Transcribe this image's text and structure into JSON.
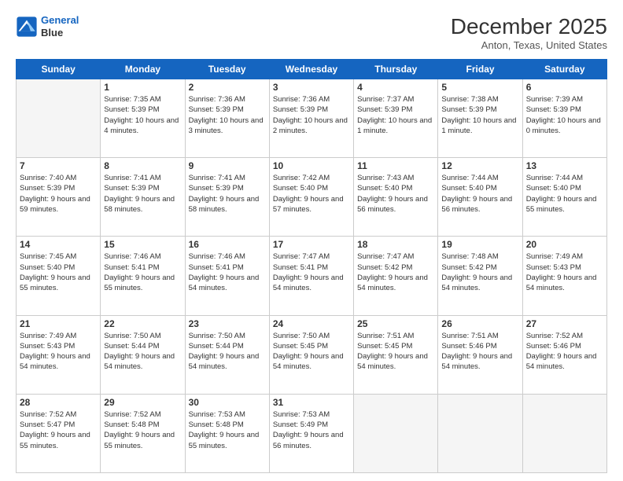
{
  "header": {
    "logo_line1": "General",
    "logo_line2": "Blue",
    "month": "December 2025",
    "location": "Anton, Texas, United States"
  },
  "days_of_week": [
    "Sunday",
    "Monday",
    "Tuesday",
    "Wednesday",
    "Thursday",
    "Friday",
    "Saturday"
  ],
  "weeks": [
    [
      {
        "day": "",
        "empty": true
      },
      {
        "day": "1",
        "sunrise": "Sunrise: 7:35 AM",
        "sunset": "Sunset: 5:39 PM",
        "daylight": "Daylight: 10 hours and 4 minutes."
      },
      {
        "day": "2",
        "sunrise": "Sunrise: 7:36 AM",
        "sunset": "Sunset: 5:39 PM",
        "daylight": "Daylight: 10 hours and 3 minutes."
      },
      {
        "day": "3",
        "sunrise": "Sunrise: 7:36 AM",
        "sunset": "Sunset: 5:39 PM",
        "daylight": "Daylight: 10 hours and 2 minutes."
      },
      {
        "day": "4",
        "sunrise": "Sunrise: 7:37 AM",
        "sunset": "Sunset: 5:39 PM",
        "daylight": "Daylight: 10 hours and 1 minute."
      },
      {
        "day": "5",
        "sunrise": "Sunrise: 7:38 AM",
        "sunset": "Sunset: 5:39 PM",
        "daylight": "Daylight: 10 hours and 1 minute."
      },
      {
        "day": "6",
        "sunrise": "Sunrise: 7:39 AM",
        "sunset": "Sunset: 5:39 PM",
        "daylight": "Daylight: 10 hours and 0 minutes."
      }
    ],
    [
      {
        "day": "7",
        "sunrise": "Sunrise: 7:40 AM",
        "sunset": "Sunset: 5:39 PM",
        "daylight": "Daylight: 9 hours and 59 minutes."
      },
      {
        "day": "8",
        "sunrise": "Sunrise: 7:41 AM",
        "sunset": "Sunset: 5:39 PM",
        "daylight": "Daylight: 9 hours and 58 minutes."
      },
      {
        "day": "9",
        "sunrise": "Sunrise: 7:41 AM",
        "sunset": "Sunset: 5:39 PM",
        "daylight": "Daylight: 9 hours and 58 minutes."
      },
      {
        "day": "10",
        "sunrise": "Sunrise: 7:42 AM",
        "sunset": "Sunset: 5:40 PM",
        "daylight": "Daylight: 9 hours and 57 minutes."
      },
      {
        "day": "11",
        "sunrise": "Sunrise: 7:43 AM",
        "sunset": "Sunset: 5:40 PM",
        "daylight": "Daylight: 9 hours and 56 minutes."
      },
      {
        "day": "12",
        "sunrise": "Sunrise: 7:44 AM",
        "sunset": "Sunset: 5:40 PM",
        "daylight": "Daylight: 9 hours and 56 minutes."
      },
      {
        "day": "13",
        "sunrise": "Sunrise: 7:44 AM",
        "sunset": "Sunset: 5:40 PM",
        "daylight": "Daylight: 9 hours and 55 minutes."
      }
    ],
    [
      {
        "day": "14",
        "sunrise": "Sunrise: 7:45 AM",
        "sunset": "Sunset: 5:40 PM",
        "daylight": "Daylight: 9 hours and 55 minutes."
      },
      {
        "day": "15",
        "sunrise": "Sunrise: 7:46 AM",
        "sunset": "Sunset: 5:41 PM",
        "daylight": "Daylight: 9 hours and 55 minutes."
      },
      {
        "day": "16",
        "sunrise": "Sunrise: 7:46 AM",
        "sunset": "Sunset: 5:41 PM",
        "daylight": "Daylight: 9 hours and 54 minutes."
      },
      {
        "day": "17",
        "sunrise": "Sunrise: 7:47 AM",
        "sunset": "Sunset: 5:41 PM",
        "daylight": "Daylight: 9 hours and 54 minutes."
      },
      {
        "day": "18",
        "sunrise": "Sunrise: 7:47 AM",
        "sunset": "Sunset: 5:42 PM",
        "daylight": "Daylight: 9 hours and 54 minutes."
      },
      {
        "day": "19",
        "sunrise": "Sunrise: 7:48 AM",
        "sunset": "Sunset: 5:42 PM",
        "daylight": "Daylight: 9 hours and 54 minutes."
      },
      {
        "day": "20",
        "sunrise": "Sunrise: 7:49 AM",
        "sunset": "Sunset: 5:43 PM",
        "daylight": "Daylight: 9 hours and 54 minutes."
      }
    ],
    [
      {
        "day": "21",
        "sunrise": "Sunrise: 7:49 AM",
        "sunset": "Sunset: 5:43 PM",
        "daylight": "Daylight: 9 hours and 54 minutes."
      },
      {
        "day": "22",
        "sunrise": "Sunrise: 7:50 AM",
        "sunset": "Sunset: 5:44 PM",
        "daylight": "Daylight: 9 hours and 54 minutes."
      },
      {
        "day": "23",
        "sunrise": "Sunrise: 7:50 AM",
        "sunset": "Sunset: 5:44 PM",
        "daylight": "Daylight: 9 hours and 54 minutes."
      },
      {
        "day": "24",
        "sunrise": "Sunrise: 7:50 AM",
        "sunset": "Sunset: 5:45 PM",
        "daylight": "Daylight: 9 hours and 54 minutes."
      },
      {
        "day": "25",
        "sunrise": "Sunrise: 7:51 AM",
        "sunset": "Sunset: 5:45 PM",
        "daylight": "Daylight: 9 hours and 54 minutes."
      },
      {
        "day": "26",
        "sunrise": "Sunrise: 7:51 AM",
        "sunset": "Sunset: 5:46 PM",
        "daylight": "Daylight: 9 hours and 54 minutes."
      },
      {
        "day": "27",
        "sunrise": "Sunrise: 7:52 AM",
        "sunset": "Sunset: 5:46 PM",
        "daylight": "Daylight: 9 hours and 54 minutes."
      }
    ],
    [
      {
        "day": "28",
        "sunrise": "Sunrise: 7:52 AM",
        "sunset": "Sunset: 5:47 PM",
        "daylight": "Daylight: 9 hours and 55 minutes."
      },
      {
        "day": "29",
        "sunrise": "Sunrise: 7:52 AM",
        "sunset": "Sunset: 5:48 PM",
        "daylight": "Daylight: 9 hours and 55 minutes."
      },
      {
        "day": "30",
        "sunrise": "Sunrise: 7:53 AM",
        "sunset": "Sunset: 5:48 PM",
        "daylight": "Daylight: 9 hours and 55 minutes."
      },
      {
        "day": "31",
        "sunrise": "Sunrise: 7:53 AM",
        "sunset": "Sunset: 5:49 PM",
        "daylight": "Daylight: 9 hours and 56 minutes."
      },
      {
        "day": "",
        "empty": true
      },
      {
        "day": "",
        "empty": true
      },
      {
        "day": "",
        "empty": true
      }
    ]
  ]
}
